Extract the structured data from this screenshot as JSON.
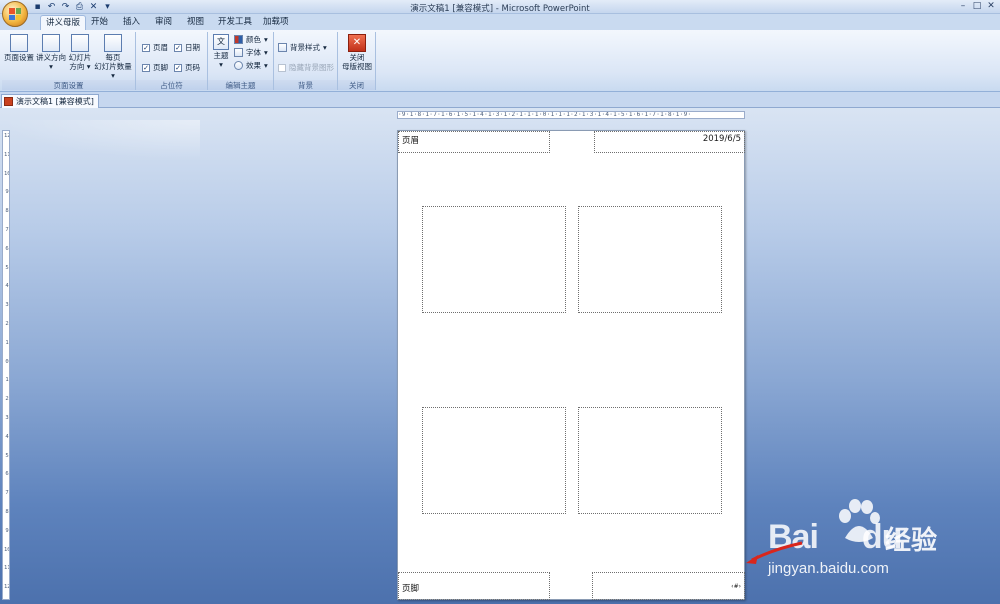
{
  "window": {
    "title": "演示文稿1 [兼容模式] - Microsoft PowerPoint"
  },
  "tabs": [
    {
      "label": "讲义母版",
      "active": true
    },
    {
      "label": "开始",
      "active": false
    },
    {
      "label": "插入",
      "active": false
    },
    {
      "label": "审阅",
      "active": false
    },
    {
      "label": "视图",
      "active": false
    },
    {
      "label": "开发工具",
      "active": false
    },
    {
      "label": "加载项",
      "active": false
    }
  ],
  "ribbon": {
    "page_setup": {
      "label": "页面设置",
      "buttons": [
        "页面设置",
        "讲义方向",
        "幻灯片",
        "方向",
        "每页",
        "幻灯片数量"
      ]
    },
    "placeholders": {
      "label": "占位符",
      "checkboxes": [
        {
          "label": "页眉",
          "checked": true
        },
        {
          "label": "日期",
          "checked": true
        },
        {
          "label": "页脚",
          "checked": true
        },
        {
          "label": "页码",
          "checked": true
        }
      ]
    },
    "edit_theme": {
      "label": "编辑主题",
      "theme": "主题",
      "colors": "颜色",
      "fonts": "字体",
      "effects": "效果"
    },
    "background": {
      "label": "背景",
      "styles": "背景样式",
      "hide": "隐藏背景图形"
    },
    "close": {
      "label": "关闭",
      "button_line1": "关闭",
      "button_line2": "母版视图"
    }
  },
  "doc_tab": {
    "label": "演示文稿1 [兼容模式]"
  },
  "ruler": {
    "horizontal": "·9·1·8·1·7·1·6·1·5·1·4·1·3·1·2·1·1·1·0·1·1·1·2·1·3·1·4·1·5·1·6·1·7·1·8·1·9·",
    "vertical": [
      "12",
      "11",
      "10",
      "9",
      "8",
      "7",
      "6",
      "5",
      "4",
      "3",
      "2",
      "1",
      "0",
      "1",
      "2",
      "3",
      "4",
      "5",
      "6",
      "7",
      "8",
      "9",
      "10",
      "11",
      "12"
    ]
  },
  "page": {
    "header": "页眉",
    "date": "2019/6/5",
    "footer": "页脚",
    "page_number": "‹#›"
  },
  "watermark": {
    "brand": "Bai",
    "brand_tail": "du",
    "cn": "经验",
    "url": "jingyan.baidu.com"
  }
}
